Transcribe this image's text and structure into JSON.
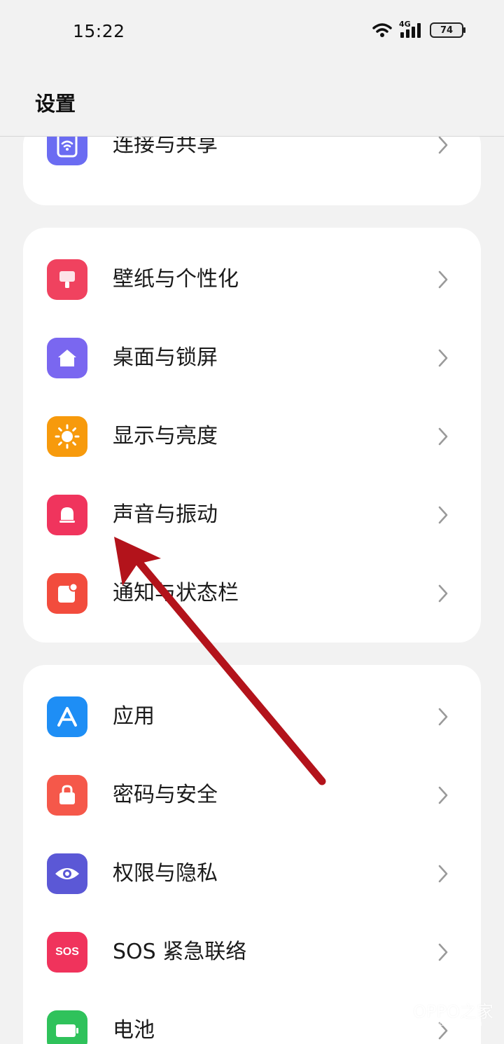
{
  "status_bar": {
    "time": "15:22",
    "network": "4G",
    "battery": "74",
    "icons": [
      "wifi-icon",
      "signal-icon",
      "battery-icon"
    ]
  },
  "header": {
    "title": "设置"
  },
  "groups": [
    {
      "items": [
        {
          "label": "连接与共享",
          "icon": "share-wifi-icon",
          "color": "#6b6cf2"
        }
      ]
    },
    {
      "items": [
        {
          "label": "壁纸与个性化",
          "icon": "wallpaper-icon",
          "color": "#f0425f"
        },
        {
          "label": "桌面与锁屏",
          "icon": "home-icon",
          "color": "#7a67f0"
        },
        {
          "label": "显示与亮度",
          "icon": "sun-icon",
          "color": "#f79a0c"
        },
        {
          "label": "声音与振动",
          "icon": "bell-icon",
          "color": "#f0345d"
        },
        {
          "label": "通知与状态栏",
          "icon": "notification-icon",
          "color": "#f24c3d"
        }
      ]
    },
    {
      "items": [
        {
          "label": "应用",
          "icon": "apps-icon",
          "color": "#1e8ef5"
        },
        {
          "label": "密码与安全",
          "icon": "lock-bag-icon",
          "color": "#f5584a"
        },
        {
          "label": "权限与隐私",
          "icon": "eye-icon",
          "color": "#5b58d6"
        },
        {
          "label": "SOS 紧急联络",
          "icon": "sos-icon",
          "color": "#f0335c",
          "icon_text": "SOS"
        },
        {
          "label": "电池",
          "icon": "battery-icon",
          "color": "#2fc25b"
        }
      ]
    }
  ],
  "annotation": {
    "type": "arrow",
    "color": "#b3131b",
    "points_to": "声音与振动"
  },
  "watermark": {
    "text": "OPPO之家",
    "sub": "www.oppo.com"
  }
}
